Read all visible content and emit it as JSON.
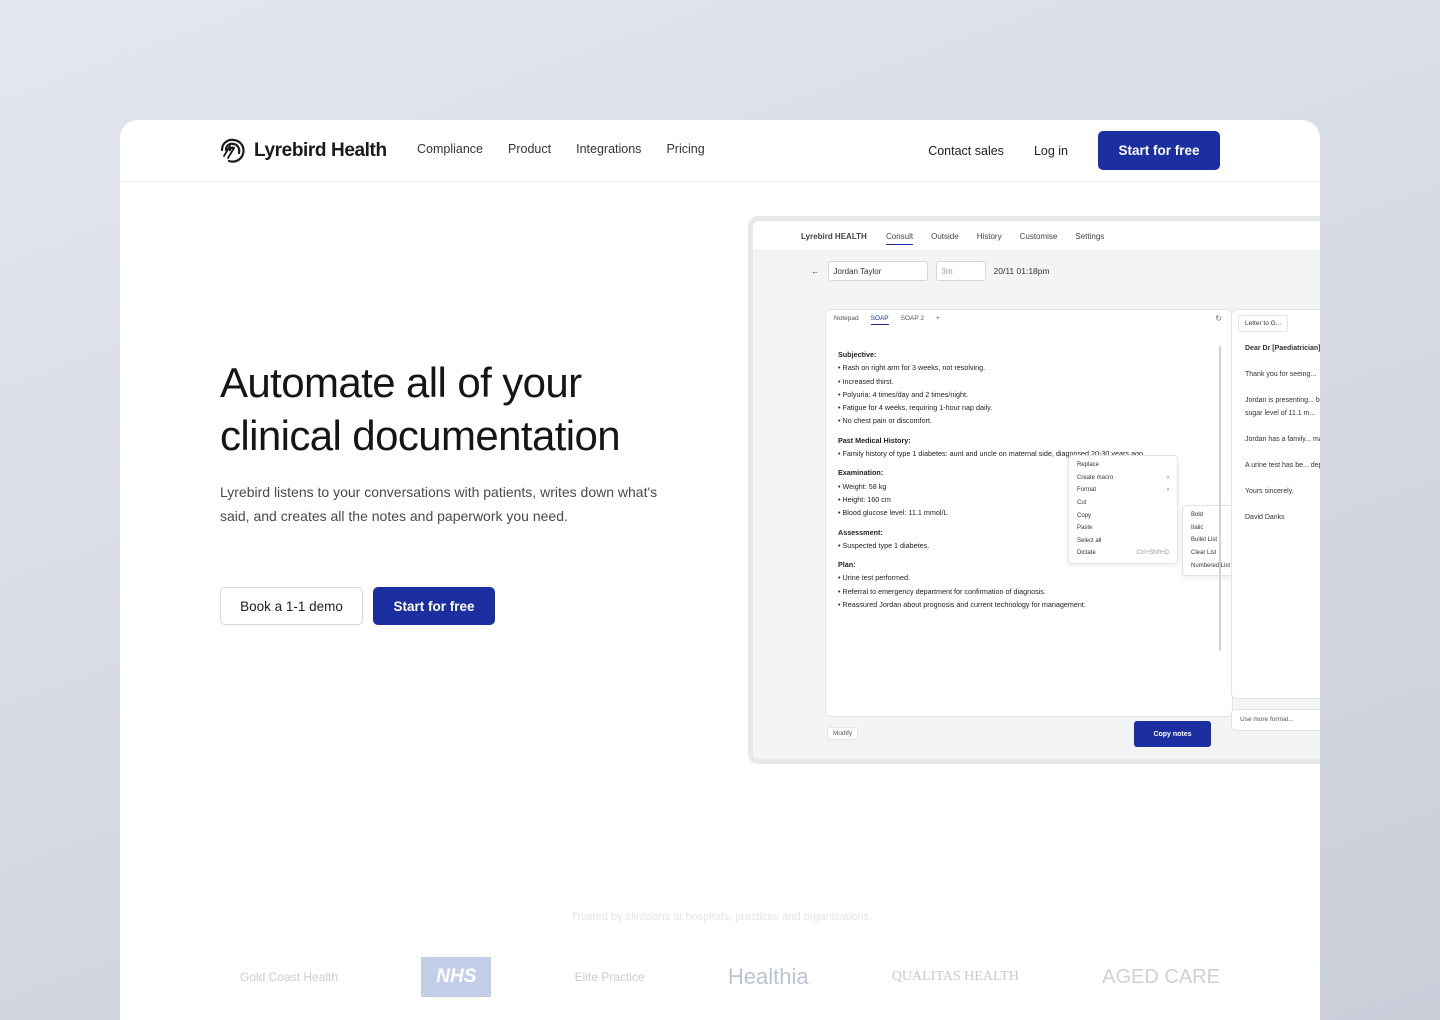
{
  "nav": {
    "brand": "Lyrebird Health",
    "links": [
      "Compliance",
      "Product",
      "Integrations",
      "Pricing"
    ],
    "contact_sales": "Contact sales",
    "log_in": "Log in",
    "cta": "Start for free"
  },
  "hero": {
    "title_line1": "Automate all of your",
    "title_line2": "clinical documentation",
    "description": "Lyrebird listens to your conversations with patients, writes down what's said, and creates all the notes and paperwork you need.",
    "demo_button": "Book a 1-1 demo",
    "cta_button": "Start for free"
  },
  "preview": {
    "brand": "Lyrebird HEALTH",
    "tabs": [
      "Consult",
      "Outside",
      "History",
      "Customise",
      "Settings"
    ],
    "patient": "Jordan Taylor",
    "duration": "3m",
    "datetime": "20/11 01:18pm",
    "note_tabs": [
      "Notepad",
      "SOAP",
      "SOAP 2"
    ],
    "note": {
      "subjective_title": "Subjective:",
      "subjective": [
        "Rash on right arm for 3 weeks, not resolving.",
        "Increased thirst.",
        "Polyuria: 4 times/day and 2 times/night.",
        "Fatigue for 4 weeks, requiring 1-hour nap daily.",
        "No chest pain or discomfort."
      ],
      "pmh_title": "Past Medical History:",
      "pmh": [
        "Family history of type 1 diabetes: aunt and uncle on maternal side, diagnosed 20-30 years ago."
      ],
      "exam_title": "Examination:",
      "exam": [
        "Weight: 58 kg",
        "Height: 160 cm",
        "Blood glucose level: 11.1 mmol/L"
      ],
      "assess_title": "Assessment:",
      "assess": [
        "Suspected type 1 diabetes."
      ],
      "plan_title": "Plan:",
      "plan": [
        "Urine test performed.",
        "Referral to emergency department for confirmation of diagnosis.",
        "Reassured Jordan about prognosis and current technology for management."
      ]
    },
    "context_menu": [
      "Replace",
      "Create macro",
      "Format",
      "Cut",
      "Copy",
      "Paste",
      "Select all",
      "Dictate"
    ],
    "context_shortcut": "Ctrl+Shift+D",
    "format_menu": [
      "Bold",
      "Italic",
      "Bullet List",
      "Clear List",
      "Numbered List"
    ],
    "letter_tab": "Letter to G...",
    "letter": [
      "Dear Dr [Paediatrician]",
      "Thank you for seeing...",
      "Jordan is presenting... been experiencing... fatigue for the pa... sugar level of 11.1 m...",
      "Jordan has a family... maternal side diag... current medication...",
      "A urine test has be... department for co...",
      "Yours sincerely,",
      "David Danks"
    ],
    "letter_input": "Use more formal...",
    "modify_label": "Modify",
    "copy_button": "Copy notes"
  },
  "trust": {
    "text": "Trusted by clinicians at hospitals, practices and organisations",
    "logos": [
      "Gold Coast Health",
      "NHS",
      "Elite Practice",
      "Healthia",
      "QUALITAS HEALTH",
      "AGED CARE"
    ]
  },
  "colors": {
    "brand_blue": "#1b2fa0",
    "background": "#d9dde6"
  }
}
